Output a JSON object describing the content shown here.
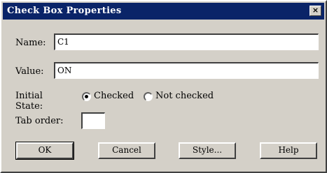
{
  "window": {
    "title": "Check Box Properties",
    "close_glyph": "×"
  },
  "form": {
    "name_label": "Name:",
    "name_value": "C1",
    "value_label": "Value:",
    "value_value": "ON",
    "initial_state_label_line1": "Initial",
    "initial_state_label_line2": "State:",
    "initial_state_options": [
      {
        "label": "Checked",
        "selected": true
      },
      {
        "label": "Not checked",
        "selected": false
      }
    ],
    "tab_order_label": "Tab order:",
    "tab_order_value": ""
  },
  "buttons": {
    "ok": "OK",
    "cancel": "Cancel",
    "style": "Style...",
    "help": "Help"
  },
  "colors": {
    "title_bar": "#0a2468",
    "dialog_face": "#d4d0c8"
  }
}
